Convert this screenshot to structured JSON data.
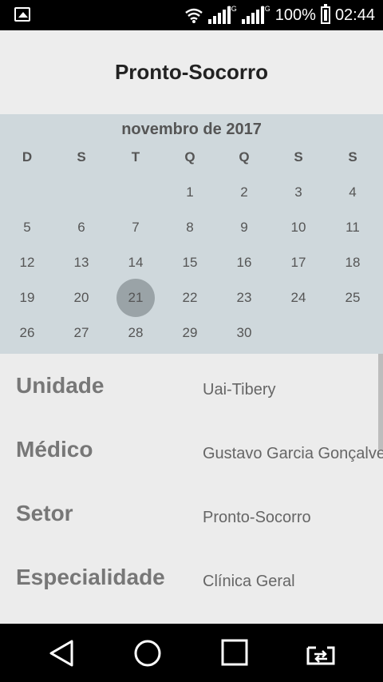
{
  "status_bar": {
    "network_left": "3G",
    "network_right": "2G",
    "battery": "100%",
    "time": "02:44"
  },
  "app_bar": {
    "title": "Pronto-Socorro"
  },
  "calendar": {
    "month_label": "novembro de 2017",
    "weekdays": [
      "D",
      "S",
      "T",
      "Q",
      "Q",
      "S",
      "S"
    ],
    "selected_day": "21",
    "weeks": [
      [
        "",
        "",
        "",
        "1",
        "2",
        "3",
        "4"
      ],
      [
        "5",
        "6",
        "7",
        "8",
        "9",
        "10",
        "11"
      ],
      [
        "12",
        "13",
        "14",
        "15",
        "16",
        "17",
        "18"
      ],
      [
        "19",
        "20",
        "21",
        "22",
        "23",
        "24",
        "25"
      ],
      [
        "26",
        "27",
        "28",
        "29",
        "30",
        "",
        ""
      ]
    ]
  },
  "details": [
    {
      "label": "Unidade",
      "value": "Uai-Tibery"
    },
    {
      "label": "Médico",
      "value": "Gustavo Garcia Gonçalves"
    },
    {
      "label": "Setor",
      "value": "Pronto-Socorro"
    },
    {
      "label": "Especialidade",
      "value": "Clínica Geral"
    }
  ],
  "icons": {
    "status_left": "gallery-icon",
    "wifi": "wifi-icon",
    "signal": "signal-icon",
    "battery": "battery-icon",
    "back": "back-icon",
    "home": "home-icon",
    "recent": "recent-apps-icon",
    "switch": "screen-switch-icon"
  }
}
